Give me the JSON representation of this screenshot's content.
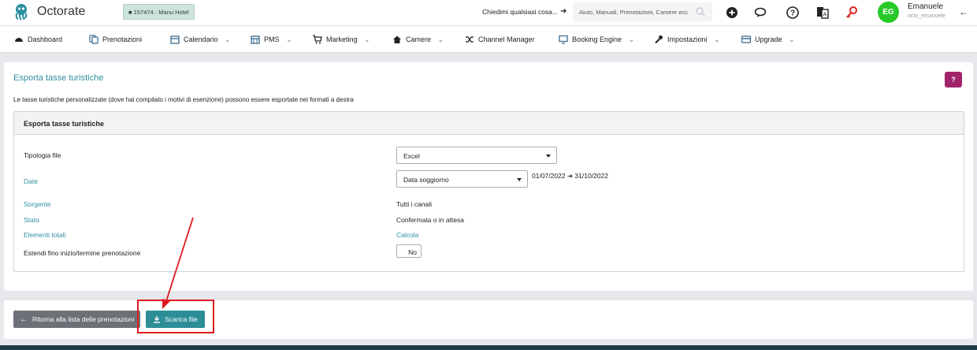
{
  "header": {
    "brand": "Octorate",
    "hotel_chip": "■ 157474 · Manu Hotel",
    "ask_prompt": "Chiedimi qualsiasi cosa...",
    "search_placeholder": "Aiuto, Manuali, Prenotazioni, Camere ecc",
    "user": {
      "initials": "EG",
      "name": "Emanuele",
      "handle": "octo_emanuele"
    },
    "icons": [
      "plus-icon",
      "chat-icon",
      "help-icon",
      "translate-icon",
      "key-icon",
      "logout-icon"
    ]
  },
  "nav": {
    "items": [
      {
        "label": "Dashboard",
        "icon": "dashboard-icon",
        "dropdown": false
      },
      {
        "label": "Prenotazioni",
        "icon": "bookings-icon",
        "dropdown": false
      },
      {
        "label": "Calendario",
        "icon": "calendar-icon",
        "dropdown": true
      },
      {
        "label": "PMS",
        "icon": "pms-icon",
        "dropdown": true
      },
      {
        "label": "Marketing",
        "icon": "cart-icon",
        "dropdown": true
      },
      {
        "label": "Camere",
        "icon": "home-icon",
        "dropdown": true
      },
      {
        "label": "Channel Manager",
        "icon": "shuffle-icon",
        "dropdown": false
      },
      {
        "label": "Booking Engine",
        "icon": "monitor-icon",
        "dropdown": true
      },
      {
        "label": "Impostazioni",
        "icon": "wrench-icon",
        "dropdown": true
      },
      {
        "label": "Upgrade",
        "icon": "card-icon",
        "dropdown": true
      }
    ]
  },
  "page": {
    "title": "Esporta tasse turistiche",
    "help_label": "?",
    "description": "Le tasse turistiche personalizzate (dove hai compilato i motivi di esenzione) possono essere esportate nei formati a destra"
  },
  "panel": {
    "title": "Esporta tasse turistiche",
    "rows": {
      "file_type": {
        "label": "Tipologia file",
        "value": "Excel"
      },
      "dates": {
        "label": "Date",
        "value": "Data soggiorno",
        "from": "01/07/2022",
        "to": "31/10/2022"
      },
      "source": {
        "label": "Sorgente",
        "value": "Tutti i canali"
      },
      "status": {
        "label": "Stato",
        "value": "Confermata o in attesa"
      },
      "total": {
        "label": "Elementi totali",
        "value": "Calcola"
      },
      "extend": {
        "label": "Estendi fino inizio/termine prenotazione",
        "value": "No"
      }
    }
  },
  "footer": {
    "back_label": "Ritorna alla lista delle prenotazioni",
    "download_label": "Scarica file"
  },
  "colors": {
    "accent": "#2f8fa3",
    "download_button": "#2d8e97",
    "help_button": "#a1246a",
    "avatar": "#27c927",
    "annotation": "#e0191e"
  }
}
